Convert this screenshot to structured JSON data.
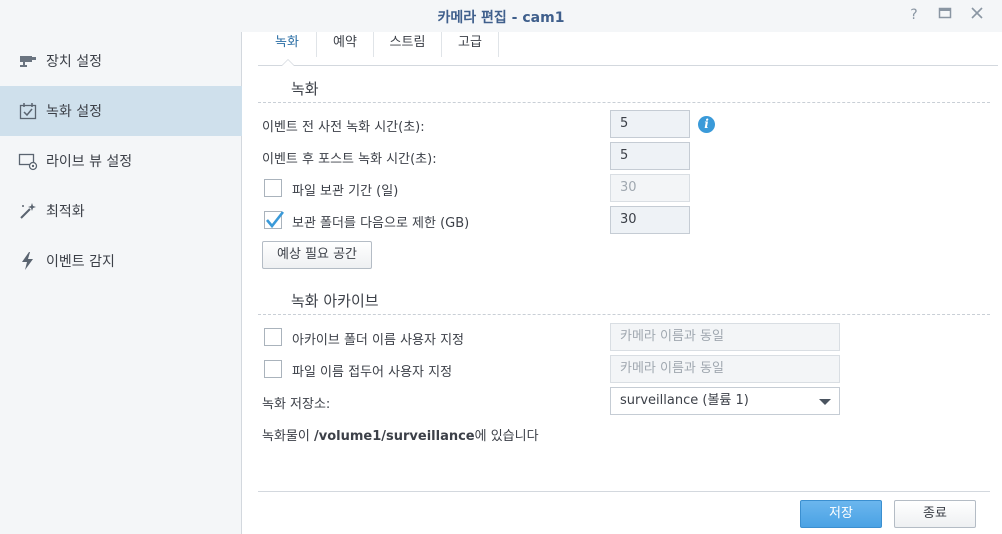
{
  "window": {
    "title": "카메라 편집 - cam1",
    "help_icon": "?",
    "maximize_icon": "□",
    "close_icon": "✕"
  },
  "sidebar": {
    "items": [
      {
        "label": "장치 설정",
        "icon": "camera-icon"
      },
      {
        "label": "녹화 설정",
        "icon": "calendar-check-icon",
        "active": true
      },
      {
        "label": "라이브 뷰 설정",
        "icon": "monitor-icon"
      },
      {
        "label": "최적화",
        "icon": "magic-wand-icon"
      },
      {
        "label": "이벤트 감지",
        "icon": "lightning-icon"
      }
    ]
  },
  "tabs": [
    {
      "label": "녹화",
      "active": true
    },
    {
      "label": "예약"
    },
    {
      "label": "스트림"
    },
    {
      "label": "고급"
    }
  ],
  "recording": {
    "section_title": "녹화",
    "pre_event_label": "이벤트 전 사전 녹화 시간(초):",
    "pre_event_value": "5",
    "post_event_label": "이벤트 후 포스트 녹화 시간(초):",
    "post_event_value": "5",
    "retention_days_label": "파일 보관 기간 (일)",
    "retention_days_value": "30",
    "retention_days_checked": false,
    "limit_folder_label": "보관 폴더를 다음으로 제한 (GB)",
    "limit_folder_value": "30",
    "limit_folder_checked": true,
    "estimate_button": "예상 필요 공간"
  },
  "archive": {
    "section_title": "녹화 아카이브",
    "custom_folder_label": "아카이브 폴더 이름 사용자 지정",
    "custom_folder_placeholder": "카메라 이름과 동일",
    "custom_prefix_label": "파일 이름 접두어 사용자 지정",
    "custom_prefix_placeholder": "카메라 이름과 동일",
    "storage_label": "녹화 저장소:",
    "storage_value": "surveillance (볼륨 1)",
    "path_prefix": "녹화물이 ",
    "path_value": "/volume1/surveillance",
    "path_suffix": "에 있습니다"
  },
  "footer": {
    "save_label": "저장",
    "close_label": "종료"
  },
  "colors": {
    "accent": "#4aa2e4",
    "title": "#3f5f8c",
    "sidebar_active": "#cfe0ec",
    "info": "#3a9ad9"
  }
}
